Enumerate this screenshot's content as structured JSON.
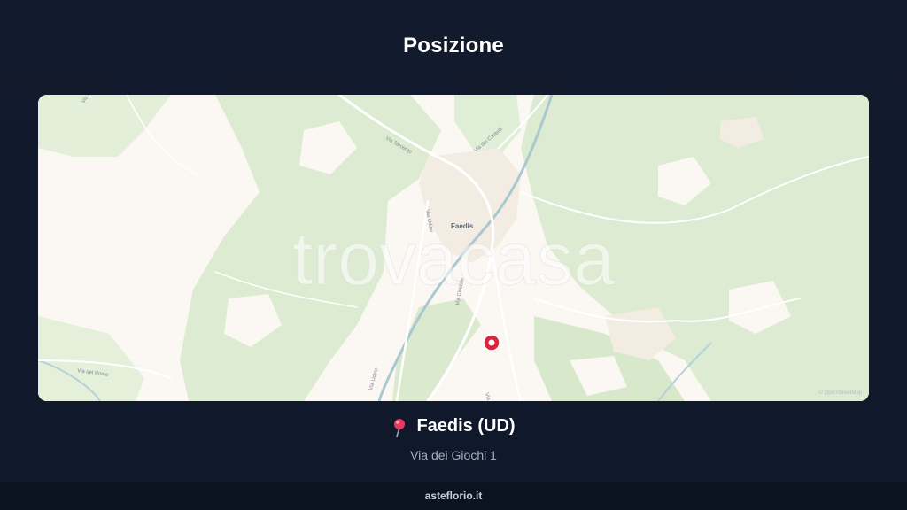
{
  "section": {
    "title": "Posizione"
  },
  "map": {
    "watermark": "trovacasa",
    "attribution": "© OpenStreetMap",
    "labels": {
      "town": "Faedis",
      "street_udine_north": "Via Udine",
      "street_udine_south": "Via Udine",
      "street_tarcento": "Via Tarcento",
      "street_castello": "Via dei Castelli",
      "street_cividale": "Via Cividale",
      "street_ponte": "Via del Ponte",
      "street_via": "Via",
      "street_nw": "Via M"
    },
    "colors": {
      "land": "#fbf7f2",
      "forest": "#dcebd1",
      "road": "#ffffff",
      "river": "#a9c8cf",
      "pin": "#d7263d"
    }
  },
  "location": {
    "town": "Faedis (UD)",
    "address": "Via dei Giochi 1",
    "icon": "pushpin-icon"
  },
  "footer": {
    "brand": "asteflorio.it"
  }
}
